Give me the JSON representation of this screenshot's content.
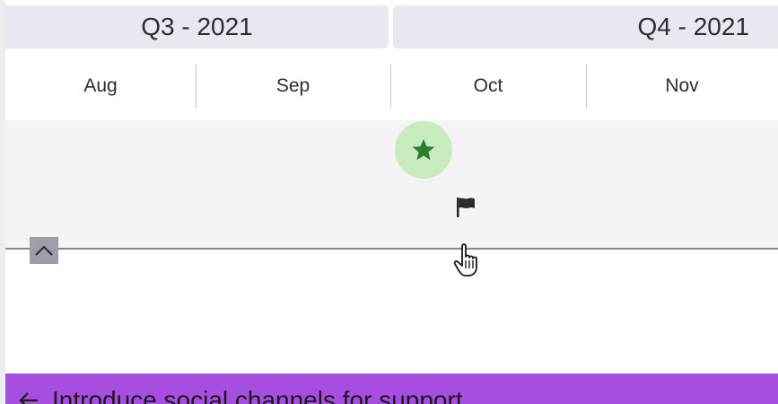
{
  "timeline": {
    "quarters": [
      {
        "label": "Q3 - 2021"
      },
      {
        "label": "Q4 - 2021"
      }
    ],
    "months": [
      {
        "label": "Aug"
      },
      {
        "label": "Sep"
      },
      {
        "label": "Oct"
      },
      {
        "label": "Nov"
      }
    ]
  },
  "markers": {
    "milestone_icon": "star-icon",
    "milestone_color": "#2e7d32",
    "milestone_bg": "#c8ecc0",
    "flag_icon": "flag-icon"
  },
  "banner": {
    "title": "Introduce social channels for support",
    "back_icon": "arrow-left-icon",
    "color": "#a64ee0"
  }
}
